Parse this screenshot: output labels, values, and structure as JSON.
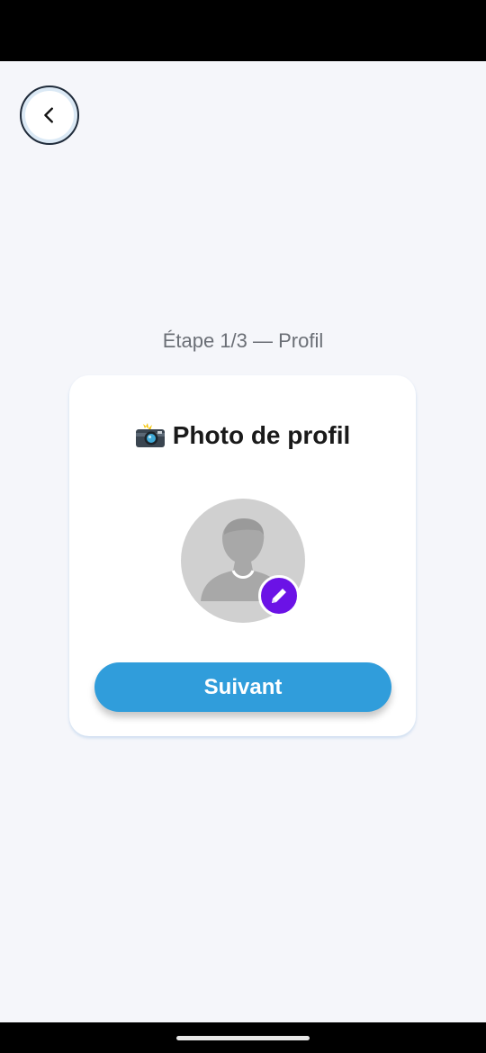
{
  "icons": {
    "back": "chevron-left-icon",
    "camera": "camera-flash-icon",
    "avatar": "person-silhouette-icon",
    "edit": "pencil-icon"
  },
  "colors": {
    "background": "#f5f6fa",
    "primary_button": "#309ddb",
    "edit_badge": "#6b12e6",
    "avatar_placeholder": "#d0d0d0"
  },
  "step": {
    "label": "Étape 1/3 — Profil"
  },
  "card": {
    "title": "Photo de profil",
    "next_label": "Suivant"
  }
}
